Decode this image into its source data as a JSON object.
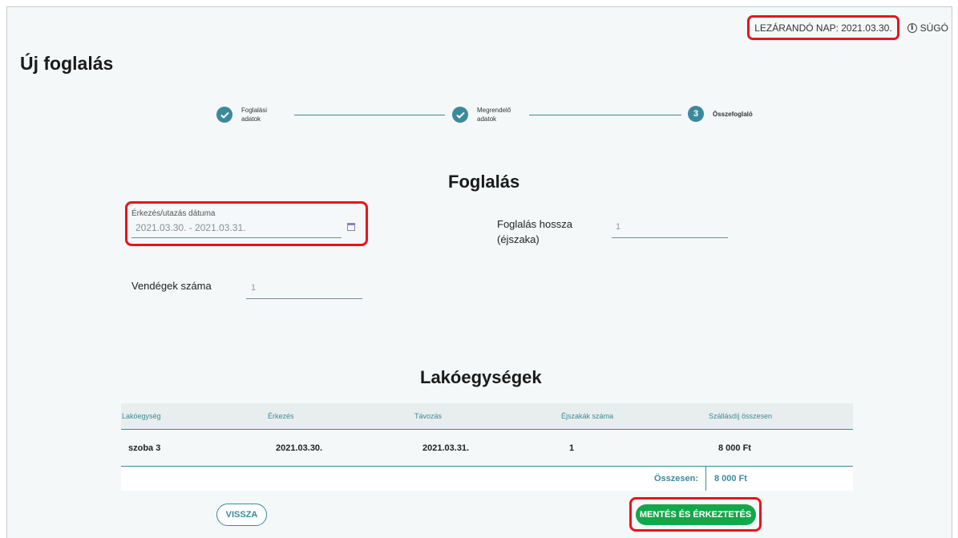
{
  "header": {
    "closing_day": "LEZÁRANDÓ NAP: 2021.03.30.",
    "help_label": "SÚGÓ",
    "help_icon": "info-icon"
  },
  "page": {
    "title": "Új foglalás"
  },
  "stepper": {
    "steps": [
      {
        "line1": "Foglalási",
        "line2": "adatok",
        "state": "done",
        "icon": "check-icon"
      },
      {
        "line1": "Megrendelő",
        "line2": "adatok",
        "state": "done",
        "icon": "check-icon"
      },
      {
        "number": "3",
        "label": "Összefoglaló",
        "state": "current"
      }
    ]
  },
  "booking": {
    "title": "Foglalás",
    "date_label": "Érkezés/utazás dátuma",
    "date_value": "2021.03.30. - 2021.03.31.",
    "calendar_icon": "calendar-icon",
    "length_label_line1": "Foglalás hossza",
    "length_label_line2": "(éjszaka)",
    "length_value": "1",
    "guests_label": "Vendégek száma",
    "guests_value": "1"
  },
  "units": {
    "title": "Lakóegységek",
    "columns": [
      "Lakóegység",
      "Érkezés",
      "Távozás",
      "Éjszakák száma",
      "Szállásdíj összesen"
    ],
    "rows": [
      [
        "szoba 3",
        "2021.03.30.",
        "2021.03.31.",
        "1",
        "8 000 Ft"
      ]
    ],
    "total_label": "Összesen:",
    "total_value": "8 000 Ft"
  },
  "actions": {
    "back_label": "VISSZA",
    "save_label": "MENTÉS ÉS ÉRKEZTETÉS"
  },
  "colors": {
    "accent": "#3b8a9c",
    "highlight": "#e8141c",
    "save_button": "#12a84a",
    "background": "#f4f8f8"
  }
}
